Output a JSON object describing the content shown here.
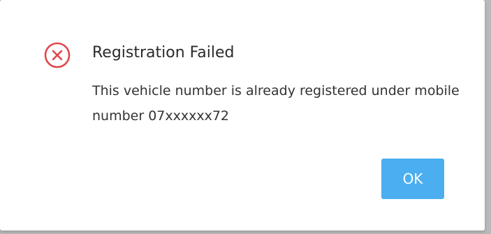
{
  "dialog": {
    "title": "Registration Failed",
    "message": "This vehicle number is already registered under mobile number 07xxxxxx72",
    "icon": "error-circle-x-icon",
    "ok_label": "OK"
  },
  "colors": {
    "error_icon": "#e0474c",
    "button": "#4aaef0",
    "title_text": "#2b2b2b",
    "body_text": "#333333",
    "backdrop": "#b9b9b9"
  }
}
